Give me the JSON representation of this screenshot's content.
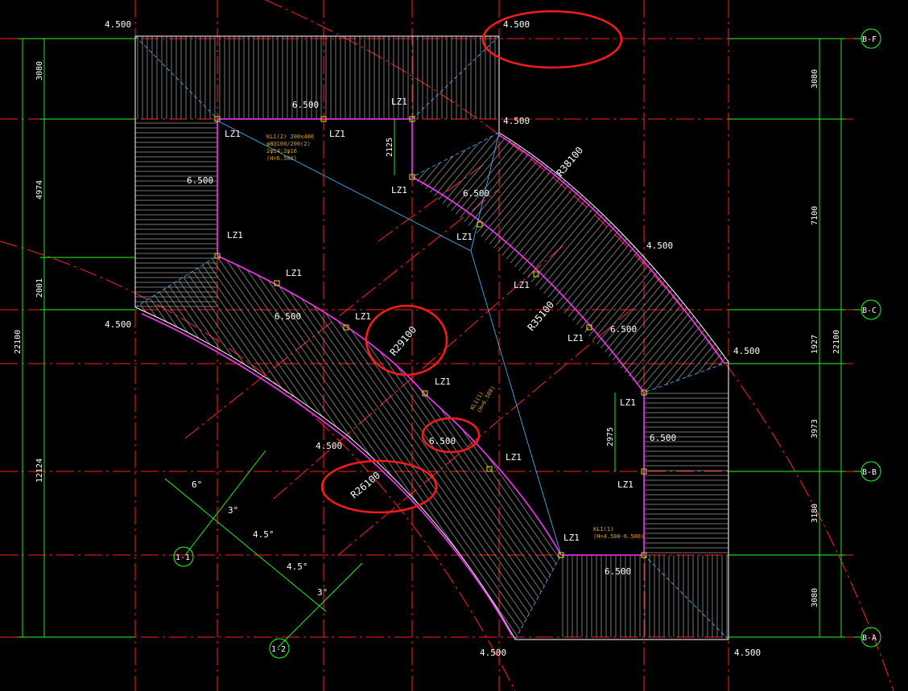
{
  "colors": {
    "background": "#000000",
    "axis_line": "#ff2020",
    "dimension": "#20ff20",
    "beam": "#ff30ff",
    "hatch": "#b0b0b0",
    "label": "#ffffff",
    "beam_tag": "#e0a020",
    "column": "#e0e000",
    "highlight": "#ff1a1a",
    "guide": "#40c0ff"
  },
  "axes": {
    "bf": "B-F",
    "bc": "B-C",
    "bb": "B-B",
    "ba": "B-A"
  },
  "dims_right": [
    "3080",
    "7100",
    "1927",
    "3973",
    "3180",
    "3080"
  ],
  "dim_right_total": "22100",
  "dims_left": [
    "3080",
    "4974",
    "2001",
    "12124"
  ],
  "dim_left_total": "22100",
  "dim_inner_1": "2125",
  "dim_inner_2": "2975",
  "elevations": {
    "tl": "4.500",
    "tr": "4.500",
    "c_mid": "4.500",
    "left_mid": "4.500",
    "r_mid": "4.500",
    "r_c": "4.500",
    "bot_left_arc": "4.500",
    "bot_a": "4.500",
    "bot_b": "4.500",
    "top_slab": "6.500",
    "left_slab": "6.500",
    "mid_top_band": "6.500",
    "band_left": "6.500",
    "band_right": "6.500",
    "center": "6.500",
    "rb_slab": "6.500",
    "bottom_slab": "6.500"
  },
  "radii": {
    "r38100": "R38100",
    "r35100": "R35100",
    "r29100": "R29100",
    "r26100": "R26100"
  },
  "columns": [
    "LZ1",
    "LZ1",
    "LZ1",
    "LZ1",
    "LZ1",
    "LZ1",
    "LZ1",
    "LZ1",
    "LZ1",
    "LZ1",
    "LZ1",
    "LZ1",
    "LZ1",
    "LZ1",
    "LZ1"
  ],
  "beam_tags": {
    "kl1_main": "KL1(2) 200x400",
    "kl1_stirrup": "φ8@100/200(2)",
    "kl1_bars": "2φ14;2φ16",
    "kl1_h": "(H=6.500)",
    "tag_a": "KL1(1)",
    "tag_a_h": "(H=4.500-6.500)",
    "tag_b": "KL1(1)",
    "tag_b_h": "(H=6.500)"
  },
  "sections": {
    "s1": "1-1",
    "s2": "1-2"
  },
  "angles": [
    "6°",
    "3°",
    "4.5°",
    "4.5°",
    "3°"
  ]
}
